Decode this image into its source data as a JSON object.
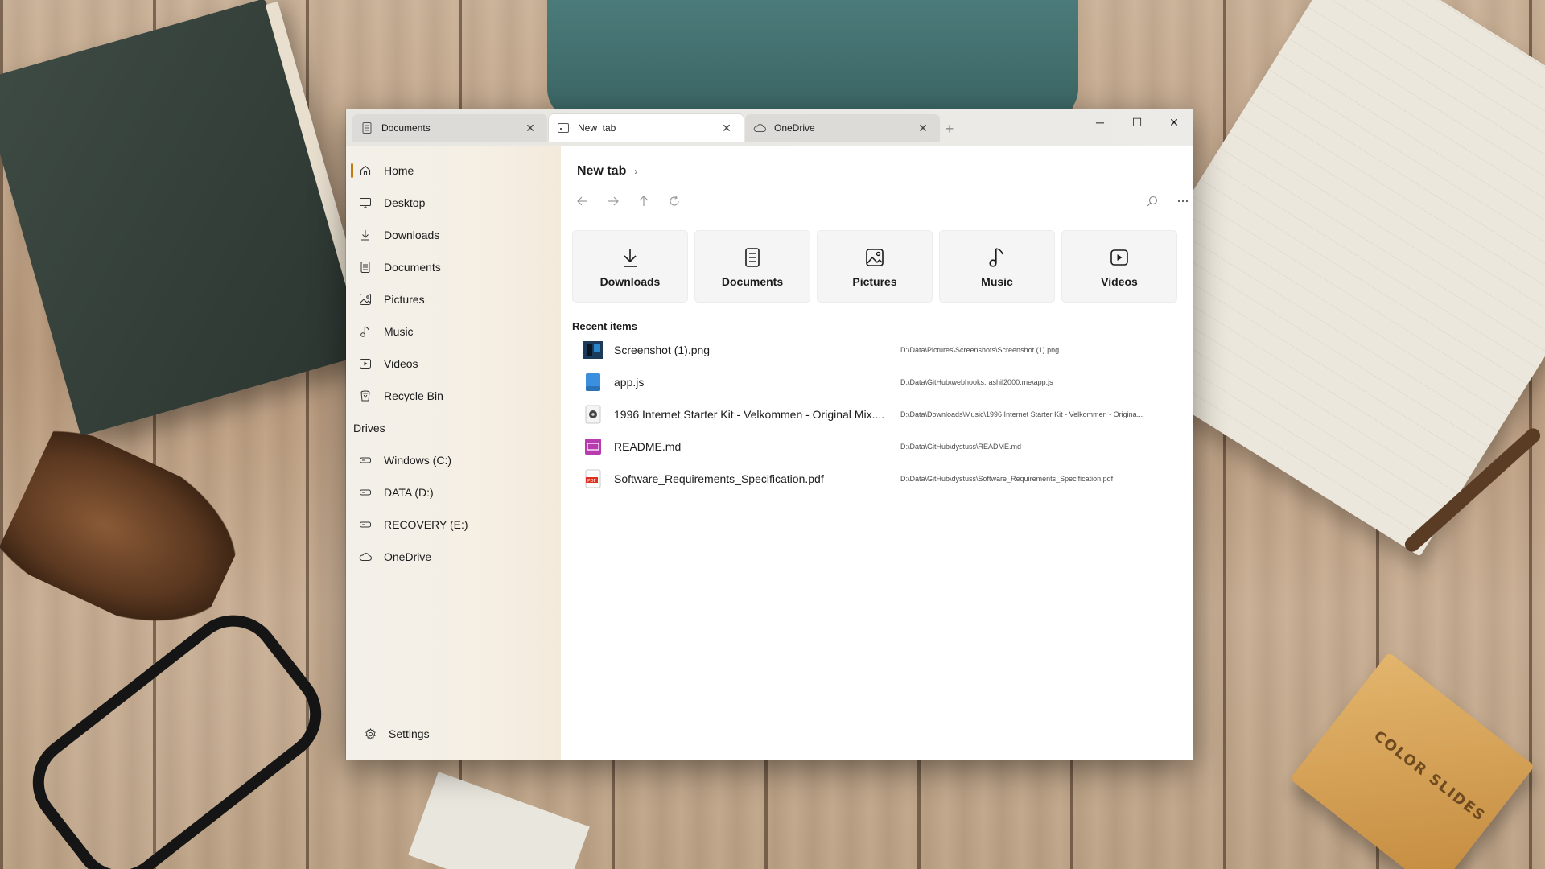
{
  "desktop": {
    "slides_box_text": "COLOR SLIDES"
  },
  "window": {
    "tabs": [
      {
        "label": "Documents",
        "icon": "document-icon"
      },
      {
        "label": "New  tab",
        "icon": "home-tab-icon"
      },
      {
        "label": "OneDrive",
        "icon": "cloud-icon"
      }
    ],
    "new_tab_symbol": "+",
    "controls": {
      "minimize": "─",
      "maximize": "☐",
      "close": "✕"
    }
  },
  "sidebar": {
    "accent_color": "#c27b12",
    "items": [
      {
        "label": "Home",
        "icon": "home-icon"
      },
      {
        "label": "Desktop",
        "icon": "desktop-icon"
      },
      {
        "label": "Downloads",
        "icon": "download-icon"
      },
      {
        "label": "Documents",
        "icon": "document-icon"
      },
      {
        "label": "Pictures",
        "icon": "picture-icon"
      },
      {
        "label": "Music",
        "icon": "music-icon"
      },
      {
        "label": "Videos",
        "icon": "video-icon"
      },
      {
        "label": "Recycle Bin",
        "icon": "recycle-bin-icon"
      }
    ],
    "drives_header": "Drives",
    "drives": [
      {
        "label": "Windows (C:)",
        "icon": "drive-icon"
      },
      {
        "label": "DATA (D:)",
        "icon": "drive-icon"
      },
      {
        "label": "RECOVERY (E:)",
        "icon": "drive-icon"
      },
      {
        "label": "OneDrive",
        "icon": "cloud-icon"
      }
    ],
    "settings_label": "Settings"
  },
  "main": {
    "breadcrumb": "New tab",
    "breadcrumb_chevron": "›",
    "quick_access": [
      {
        "label": "Downloads",
        "icon": "download-icon"
      },
      {
        "label": "Documents",
        "icon": "document-icon"
      },
      {
        "label": "Pictures",
        "icon": "picture-icon"
      },
      {
        "label": "Music",
        "icon": "music-icon"
      },
      {
        "label": "Videos",
        "icon": "video-icon"
      }
    ],
    "recent_title": "Recent items",
    "recent_items": [
      {
        "name": "Screenshot (1).png",
        "path": "D:\\Data\\Pictures\\Screenshots\\Screenshot (1).png",
        "icon": "image-file-icon"
      },
      {
        "name": "app.js",
        "path": "D:\\Data\\GitHub\\webhooks.rashil2000.me\\app.js",
        "icon": "js-file-icon"
      },
      {
        "name": "1996 Internet Starter Kit - Velkommen - Original Mix....",
        "path": "D:\\Data\\Downloads\\Music\\1996 Internet Starter Kit - Velkommen - Origina...",
        "icon": "audio-file-icon"
      },
      {
        "name": "README.md",
        "path": "D:\\Data\\GitHub\\dystuss\\README.md",
        "icon": "markdown-file-icon"
      },
      {
        "name": "Software_Requirements_Specification.pdf",
        "path": "D:\\Data\\GitHub\\dystuss\\Software_Requirements_Specification.pdf",
        "icon": "pdf-file-icon"
      }
    ]
  }
}
